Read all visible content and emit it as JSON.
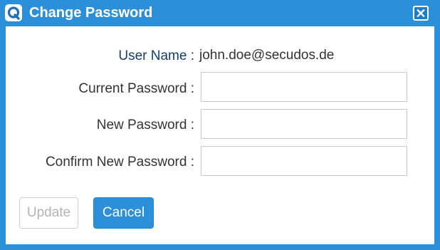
{
  "window": {
    "title": "Change Password",
    "close_icon": "close-icon",
    "logo_icon": "app-logo-icon"
  },
  "form": {
    "user_name_label": "User Name :",
    "user_name_value": "john.doe@secudos.de",
    "current_password_label": "Current Password :",
    "current_password_value": "",
    "new_password_label": "New Password :",
    "new_password_value": "",
    "confirm_password_label": "Confirm New Password :",
    "confirm_password_value": ""
  },
  "buttons": {
    "update_label": "Update",
    "update_disabled": true,
    "cancel_label": "Cancel"
  },
  "colors": {
    "accent": "#2b90d9",
    "user_label": "#123e6d",
    "disabled_text": "#b3b3b3"
  }
}
